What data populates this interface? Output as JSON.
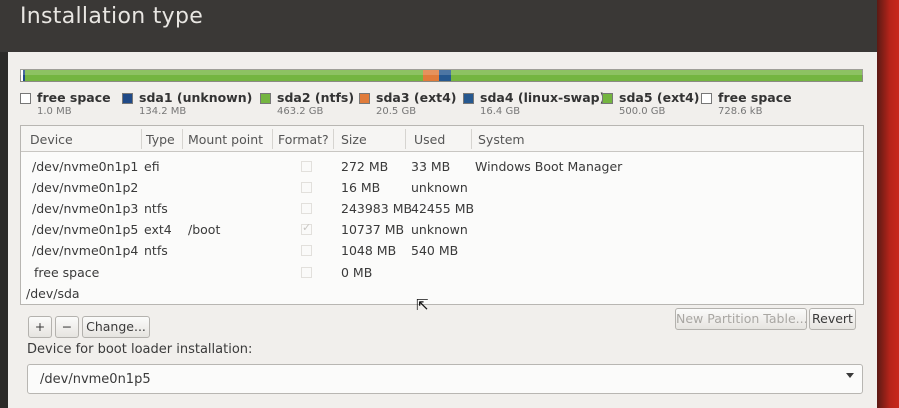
{
  "window": {
    "title": "Installation type"
  },
  "legend": [
    {
      "name": "free space",
      "size": "1.0 MB",
      "color": "#ffffff"
    },
    {
      "name": "sda1 (unknown)",
      "size": "134.2 MB",
      "color": "#204a87"
    },
    {
      "name": "sda2 (ntfs)",
      "size": "463.2 GB",
      "color": "#74b540"
    },
    {
      "name": "sda3 (ext4)",
      "size": "20.5 GB",
      "color": "#e07b3a"
    },
    {
      "name": "sda4 (linux-swap)",
      "size": "16.4 GB",
      "color": "#26588f"
    },
    {
      "name": "sda5 (ext4)",
      "size": "500.0 GB",
      "color": "#74b540"
    },
    {
      "name": "free space",
      "size": "728.6 kB",
      "color": "#ffffff"
    }
  ],
  "table": {
    "headers": [
      "Device",
      "Type",
      "Mount point",
      "Format?",
      "Size",
      "Used",
      "System"
    ],
    "rows": [
      {
        "device": "/dev/nvme0n1p1",
        "type": "efi",
        "mount": "",
        "format": false,
        "size": "272 MB",
        "used": "33 MB",
        "system": "Windows Boot Manager"
      },
      {
        "device": "/dev/nvme0n1p2",
        "type": "",
        "mount": "",
        "format": false,
        "size": "16 MB",
        "used": "unknown",
        "system": ""
      },
      {
        "device": "/dev/nvme0n1p3",
        "type": "ntfs",
        "mount": "",
        "format": false,
        "size": "243983 MB",
        "used": "42455 MB",
        "system": ""
      },
      {
        "device": "/dev/nvme0n1p5",
        "type": "ext4",
        "mount": "/boot",
        "format": true,
        "size": "10737 MB",
        "used": "unknown",
        "system": ""
      },
      {
        "device": "/dev/nvme0n1p4",
        "type": "ntfs",
        "mount": "",
        "format": false,
        "size": "1048 MB",
        "used": "540 MB",
        "system": ""
      },
      {
        "device": "free space",
        "type": "",
        "mount": "",
        "format": false,
        "size": "0 MB",
        "used": "",
        "system": ""
      },
      {
        "device": "/dev/sda",
        "type": "",
        "mount": "",
        "format": null,
        "size": "",
        "used": "",
        "system": ""
      }
    ]
  },
  "buttons": {
    "add": "+",
    "remove": "−",
    "change": "Change...",
    "new_partition_table": "New Partition Table...",
    "revert": "Revert"
  },
  "bootloader": {
    "label": "Device for boot loader installation:",
    "value": "/dev/nvme0n1p5"
  }
}
